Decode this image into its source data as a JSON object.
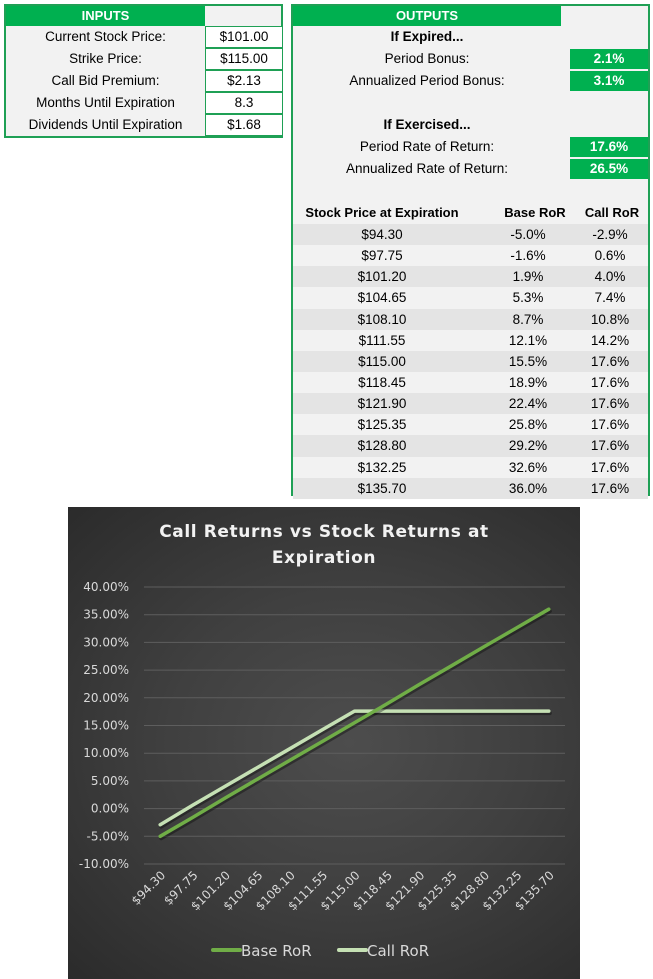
{
  "inputs": {
    "title": "INPUTS",
    "rows": [
      {
        "label": "Current Stock Price:",
        "value": "$101.00"
      },
      {
        "label": "Strike Price:",
        "value": "$115.00"
      },
      {
        "label": "Call Bid Premium:",
        "value": "$2.13"
      },
      {
        "label": "Months Until Expiration",
        "value": "8.3"
      },
      {
        "label": "Dividends Until Expiration",
        "value": "$1.68"
      }
    ]
  },
  "outputs": {
    "title": "OUTPUTS",
    "expired_heading": "If Expired...",
    "period_bonus_label": "Period Bonus:",
    "period_bonus_value": "2.1%",
    "annualized_bonus_label": "Annualized Period Bonus:",
    "annualized_bonus_value": "3.1%",
    "exercised_heading": "If Exercised...",
    "period_ror_label": "Period Rate of Return:",
    "period_ror_value": "17.6%",
    "annualized_ror_label": "Annualized Rate of Return:",
    "annualized_ror_value": "26.5%",
    "returns_table": {
      "headers": [
        "Stock Price at Expiration",
        "Base RoR",
        "Call RoR"
      ],
      "rows": [
        [
          "$94.30",
          "-5.0%",
          "-2.9%"
        ],
        [
          "$97.75",
          "-1.6%",
          "0.6%"
        ],
        [
          "$101.20",
          "1.9%",
          "4.0%"
        ],
        [
          "$104.65",
          "5.3%",
          "7.4%"
        ],
        [
          "$108.10",
          "8.7%",
          "10.8%"
        ],
        [
          "$111.55",
          "12.1%",
          "14.2%"
        ],
        [
          "$115.00",
          "15.5%",
          "17.6%"
        ],
        [
          "$118.45",
          "18.9%",
          "17.6%"
        ],
        [
          "$121.90",
          "22.4%",
          "17.6%"
        ],
        [
          "$125.35",
          "25.8%",
          "17.6%"
        ],
        [
          "$128.80",
          "29.2%",
          "17.6%"
        ],
        [
          "$132.25",
          "32.6%",
          "17.6%"
        ],
        [
          "$135.70",
          "36.0%",
          "17.6%"
        ]
      ]
    }
  },
  "colors": {
    "header_green": "#00b050",
    "border_green": "#1fa055",
    "base_line": "#70ad47",
    "call_line": "#c5e0b4"
  },
  "chart_data": {
    "type": "line",
    "title": "Call Returns vs Stock Returns at Expiration",
    "title_lines": [
      "Call Returns vs Stock Returns at",
      "Expiration"
    ],
    "xlabel": "",
    "ylabel": "",
    "categories": [
      "$94.30",
      "$97.75",
      "$101.20",
      "$104.65",
      "$108.10",
      "$111.55",
      "$115.00",
      "$118.45",
      "$121.90",
      "$125.35",
      "$128.80",
      "$132.25",
      "$135.70"
    ],
    "series": [
      {
        "name": "Base RoR",
        "values": [
          -0.05,
          -0.016,
          0.019,
          0.053,
          0.087,
          0.121,
          0.155,
          0.189,
          0.224,
          0.258,
          0.292,
          0.326,
          0.36
        ]
      },
      {
        "name": "Call RoR",
        "values": [
          -0.029,
          0.006,
          0.04,
          0.074,
          0.108,
          0.142,
          0.176,
          0.176,
          0.176,
          0.176,
          0.176,
          0.176,
          0.176
        ]
      }
    ],
    "ylim": [
      -0.1,
      0.4
    ],
    "ytick_step": 0.05,
    "ytick_labels": [
      "40.00%",
      "35.00%",
      "30.00%",
      "25.00%",
      "20.00%",
      "15.00%",
      "10.00%",
      "5.00%",
      "0.00%",
      "-5.00%",
      "-10.00%"
    ],
    "grid": true,
    "legend": "bottom"
  }
}
